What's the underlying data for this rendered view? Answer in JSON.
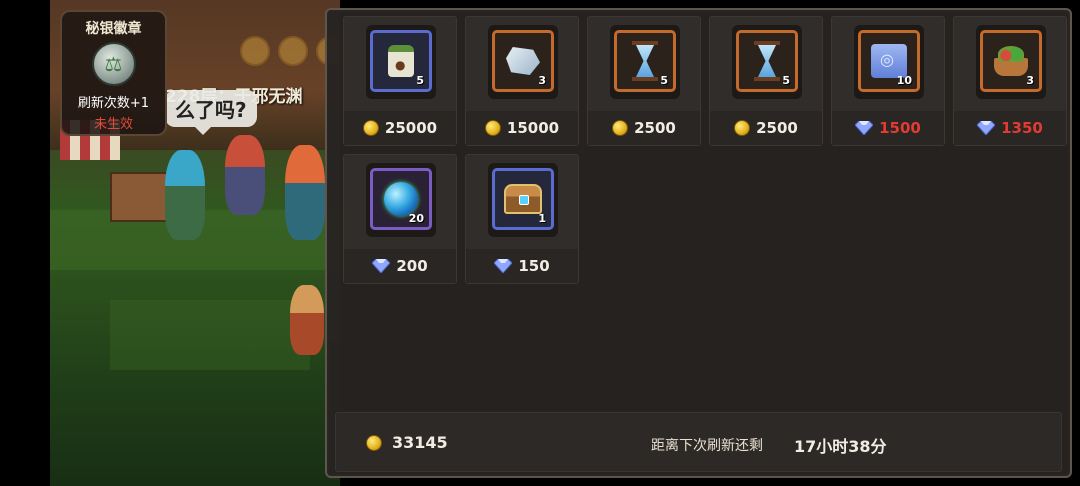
{
  "badge": {
    "title": "秘银徽章",
    "effect": "刷新次数+1",
    "status": "未生效",
    "emblem_glyph": "⚖"
  },
  "scene": {
    "floor_text": "228层：于邪无渊",
    "speech": "么了吗?"
  },
  "shop": {
    "items": [
      {
        "name": "paw-jar",
        "qty": "5",
        "currency": "coin",
        "price": "25000",
        "frame": "blue",
        "price_color": "normal"
      },
      {
        "name": "crystal-stone",
        "qty": "3",
        "currency": "coin",
        "price": "15000",
        "frame": "orange",
        "price_color": "normal"
      },
      {
        "name": "hourglass",
        "qty": "5",
        "currency": "coin",
        "price": "2500",
        "frame": "orange",
        "price_color": "normal"
      },
      {
        "name": "hourglass",
        "qty": "5",
        "currency": "coin",
        "price": "2500",
        "frame": "orange",
        "price_color": "normal"
      },
      {
        "name": "blue-scroll",
        "qty": "10",
        "currency": "diamond",
        "price": "1500",
        "frame": "orange",
        "price_color": "red"
      },
      {
        "name": "food-basket",
        "qty": "3",
        "currency": "diamond",
        "price": "1350",
        "frame": "orange",
        "price_color": "red"
      },
      {
        "name": "green-orb",
        "qty": "20",
        "currency": "diamond",
        "price": "200",
        "frame": "purple",
        "price_color": "normal"
      },
      {
        "name": "treasure-chest",
        "qty": "1",
        "currency": "diamond",
        "price": "150",
        "frame": "blue",
        "price_color": "normal"
      }
    ]
  },
  "footer": {
    "gold_amount": "33145",
    "refresh_label": "距离下次刷新还剩",
    "refresh_time": "17小时38分"
  },
  "colors": {
    "price_red": "#e23b34",
    "frame_orange": "#c46a2c",
    "frame_purple": "#7b5cc4",
    "frame_blue": "#5a6cd0"
  }
}
